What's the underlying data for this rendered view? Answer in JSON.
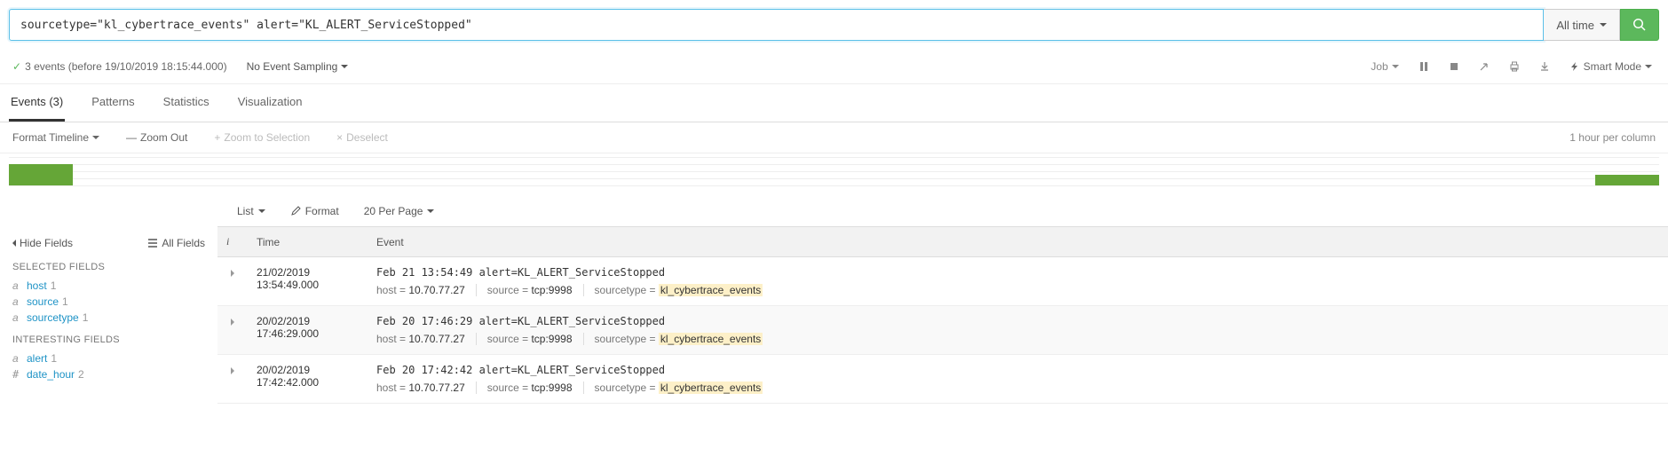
{
  "search": {
    "query": "sourcetype=\"kl_cybertrace_events\" alert=\"KL_ALERT_ServiceStopped\"",
    "time_picker": "All time"
  },
  "status": {
    "text": "3 events (before 19/10/2019 18:15:44.000)",
    "sampling": "No Event Sampling",
    "job": "Job",
    "smart_mode": "Smart Mode"
  },
  "tabs": {
    "events_label": "Events (3)",
    "patterns": "Patterns",
    "statistics": "Statistics",
    "visualization": "Visualization"
  },
  "timeline": {
    "format": "Format Timeline",
    "zoom_out": "Zoom Out",
    "zoom_sel": "Zoom to Selection",
    "deselect": "Deselect",
    "per_col": "1 hour per column"
  },
  "sidebar": {
    "hide_fields": "Hide Fields",
    "all_fields": "All Fields",
    "selected_title": "SELECTED FIELDS",
    "interesting_title": "INTERESTING FIELDS",
    "selected": [
      {
        "type": "a",
        "name": "host",
        "count": "1"
      },
      {
        "type": "a",
        "name": "source",
        "count": "1"
      },
      {
        "type": "a",
        "name": "sourcetype",
        "count": "1"
      }
    ],
    "interesting": [
      {
        "type": "a",
        "name": "alert",
        "count": "1"
      },
      {
        "type": "#",
        "name": "date_hour",
        "count": "2"
      }
    ]
  },
  "events_toolbar": {
    "list": "List",
    "format": "Format",
    "per_page": "20 Per Page"
  },
  "table": {
    "headers": {
      "i": "i",
      "time": "Time",
      "event": "Event"
    },
    "meta_labels": {
      "host": "host = ",
      "source": "source = ",
      "sourcetype": "sourcetype = "
    },
    "rows": [
      {
        "date": "21/02/2019",
        "time": "13:54:49.000",
        "raw": "Feb 21 13:54:49 alert=KL_ALERT_ServiceStopped",
        "host": "10.70.77.27",
        "source": "tcp:9998",
        "sourcetype": "kl_cybertrace_events"
      },
      {
        "date": "20/02/2019",
        "time": "17:46:29.000",
        "raw": "Feb 20 17:46:29 alert=KL_ALERT_ServiceStopped",
        "host": "10.70.77.27",
        "source": "tcp:9998",
        "sourcetype": "kl_cybertrace_events"
      },
      {
        "date": "20/02/2019",
        "time": "17:42:42.000",
        "raw": "Feb 20 17:42:42 alert=KL_ALERT_ServiceStopped",
        "host": "10.70.77.27",
        "source": "tcp:9998",
        "sourcetype": "kl_cybertrace_events"
      }
    ]
  }
}
